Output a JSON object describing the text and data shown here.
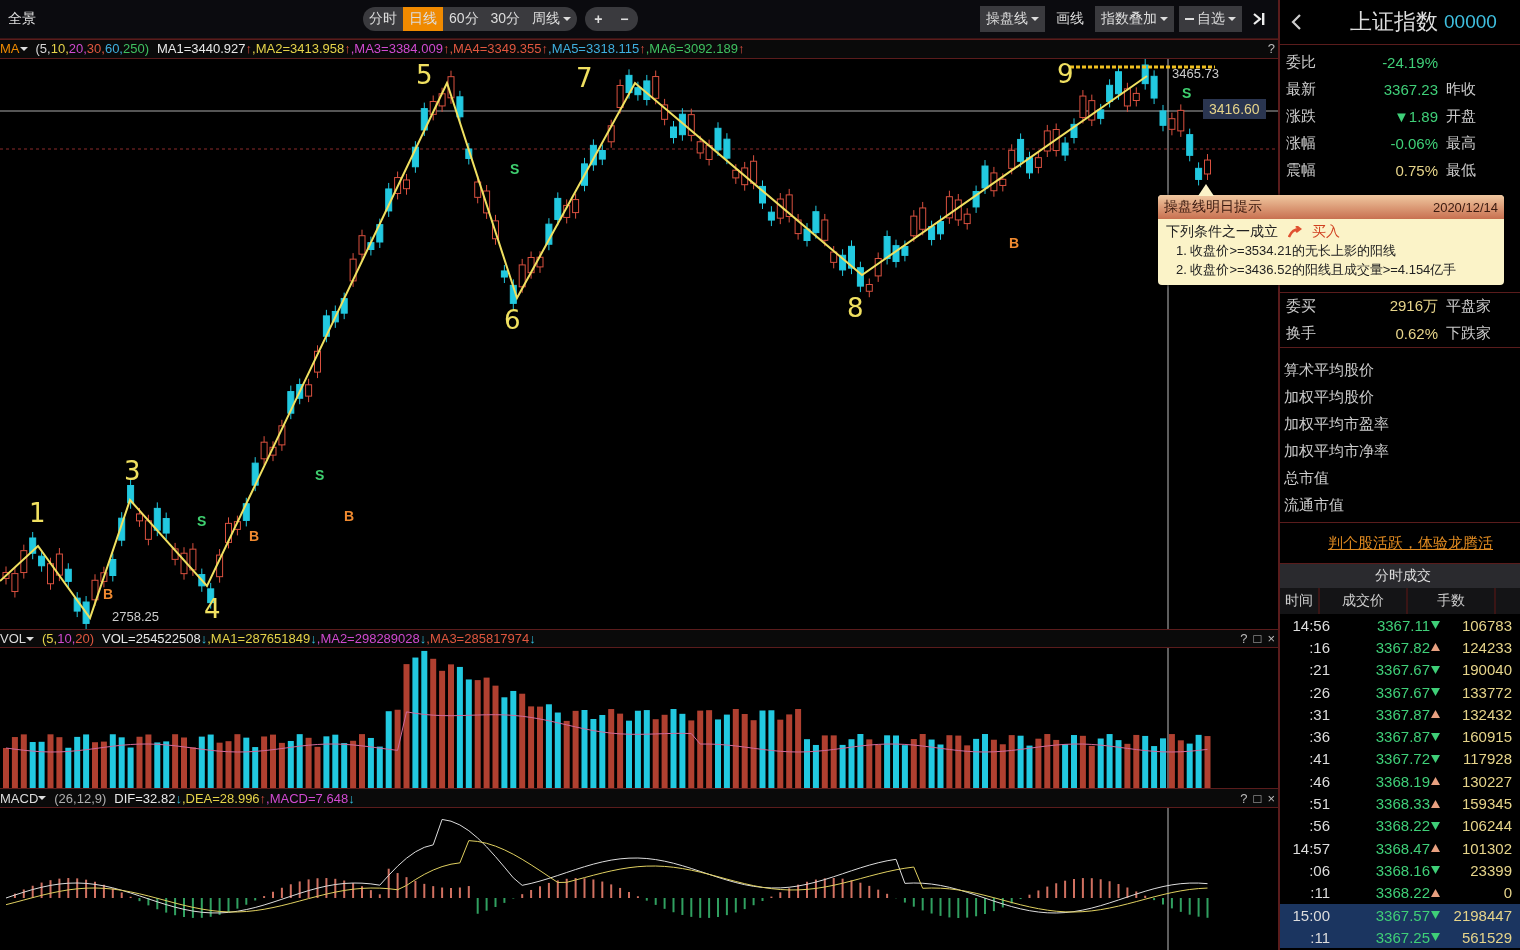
{
  "toolbar": {
    "title": "全景",
    "periods": [
      {
        "label": "分时",
        "selected": false
      },
      {
        "label": "日线",
        "selected": true
      },
      {
        "label": "60分",
        "selected": false
      },
      {
        "label": "30分",
        "selected": false
      },
      {
        "label": "周线",
        "selected": false,
        "dropdown": true
      }
    ],
    "zoom": [
      "+",
      "−"
    ],
    "tools": [
      {
        "label": "操盘线",
        "dropdown": true,
        "minus": false
      },
      {
        "label": "画线",
        "dropdown": false,
        "minus": false
      },
      {
        "label": "指数叠加",
        "dropdown": true,
        "minus": false
      },
      {
        "label": "自选",
        "dropdown": true,
        "minus": true
      }
    ]
  },
  "ma_row": {
    "name": "MA",
    "params": [
      "(5,",
      "10,",
      "20,",
      "30,",
      "60,",
      "250)"
    ],
    "values": [
      {
        "label": "MA1=3440.927",
        "arrow": "↑",
        "rising": true
      },
      {
        "label": ",MA2=3413.958",
        "arrow": "↑",
        "rising": true
      },
      {
        "label": ",MA3=3384.009",
        "arrow": "↑",
        "rising": true
      },
      {
        "label": ",MA4=3349.355",
        "arrow": "↑",
        "rising": true
      },
      {
        "label": ",MA5=3318.115",
        "arrow": "↑",
        "rising": true
      },
      {
        "label": ",MA6=3092.189",
        "arrow": "↑",
        "rising": true
      }
    ],
    "help": "?"
  },
  "chart": {
    "waves": [
      {
        "label": "1"
      },
      {
        "label": "3"
      },
      {
        "label": "4"
      },
      {
        "label": "5"
      },
      {
        "label": "6"
      },
      {
        "label": "7"
      },
      {
        "label": "8"
      },
      {
        "label": "9"
      }
    ],
    "signals": [
      {
        "kind": "buy",
        "text": "B"
      },
      {
        "kind": "sell",
        "text": "S"
      },
      {
        "kind": "buy",
        "text": "B"
      },
      {
        "kind": "sell",
        "text": "S"
      },
      {
        "kind": "buy",
        "text": "B"
      },
      {
        "kind": "sell",
        "text": "S"
      },
      {
        "kind": "buy",
        "text": "B"
      },
      {
        "kind": "sell",
        "text": "S"
      }
    ],
    "low_label": "2758.25",
    "high_label": "3465.73",
    "crosshair_price": "3416.60"
  },
  "vol": {
    "name": "VOL",
    "params": [
      "(5,",
      "10,",
      "20)"
    ],
    "values": [
      {
        "label": "VOL=254522508",
        "arrow": "↓",
        "rising": false
      },
      {
        "label": ",MA1=287651849",
        "arrow": "↓",
        "rising": false
      },
      {
        "label": ",MA2=298289028",
        "arrow": "↓",
        "rising": false
      },
      {
        "label": ",MA3=285817974",
        "arrow": "↓",
        "rising": false
      }
    ],
    "controls": [
      "?",
      "□",
      "×"
    ]
  },
  "macd": {
    "name": "MACD",
    "params": [
      "(26,12,9)"
    ],
    "values": [
      {
        "label": "DIF=32.82",
        "arrow": "↓",
        "rising": false
      },
      {
        "label": ",DEA=28.996",
        "arrow": "↑",
        "rising": true
      },
      {
        "label": ",MACD=7.648",
        "arrow": "↓",
        "rising": false
      }
    ],
    "controls": [
      "?",
      "□",
      "×"
    ]
  },
  "tooltip": {
    "title": "操盘线明日提示",
    "date": "2020/12/14",
    "condition": "下列条件之一成立",
    "action": "买入",
    "items": [
      "1. 收盘价>=3534.21的无长上影的阳线",
      "2. 收盘价>=3436.52的阳线且成交量>=4.154亿手"
    ]
  },
  "panel": {
    "title": "上证指数",
    "code": "00000",
    "quotes_top": [
      {
        "label": "委比",
        "value": "-24.19%",
        "negative": true
      },
      {
        "label": "最新",
        "value": "3367.23",
        "negative": true,
        "label2": "昨收"
      },
      {
        "label": "涨跌",
        "value": "▼1.89",
        "negative": true,
        "label2": "开盘"
      },
      {
        "label": "涨幅",
        "value": "-0.06%",
        "negative": true,
        "label2": "最高"
      },
      {
        "label": "震幅",
        "value": "0.75%",
        "negative": false,
        "label2": "最低"
      }
    ],
    "quotes_bottom": [
      {
        "label": "委买",
        "value": "2916万",
        "negative": false,
        "label2": "平盘家"
      },
      {
        "label": "换手",
        "value": "0.62%",
        "negative": false,
        "label2": "下跌家"
      }
    ],
    "stats": [
      "算术平均股价",
      "加权平均股价",
      "加权平均市盈率",
      "加权平均市净率",
      "总市值",
      "流通市值"
    ],
    "promo": "判个股活跃，体验龙腾活",
    "trades_tab": "分时成交",
    "columns": [
      "时间",
      "成交价",
      "手数"
    ],
    "trades": [
      {
        "time": "14:56",
        "price": "3367.11",
        "rising": false,
        "volume": "106783",
        "selected": false
      },
      {
        "time": ":16",
        "price": "3367.82",
        "rising": true,
        "volume": "124233",
        "selected": false
      },
      {
        "time": ":21",
        "price": "3367.67",
        "rising": false,
        "volume": "190040",
        "selected": false
      },
      {
        "time": ":26",
        "price": "3367.67",
        "rising": false,
        "volume": "133772",
        "selected": false
      },
      {
        "time": ":31",
        "price": "3367.87",
        "rising": true,
        "volume": "132432",
        "selected": false
      },
      {
        "time": ":36",
        "price": "3367.87",
        "rising": false,
        "volume": "160915",
        "selected": false
      },
      {
        "time": ":41",
        "price": "3367.72",
        "rising": false,
        "volume": "117928",
        "selected": false
      },
      {
        "time": ":46",
        "price": "3368.19",
        "rising": true,
        "volume": "130227",
        "selected": false
      },
      {
        "time": ":51",
        "price": "3368.33",
        "rising": true,
        "volume": "159345",
        "selected": false
      },
      {
        "time": ":56",
        "price": "3368.22",
        "rising": false,
        "volume": "106244",
        "selected": false
      },
      {
        "time": "14:57",
        "price": "3368.47",
        "rising": true,
        "volume": "101302",
        "selected": false
      },
      {
        "time": ":06",
        "price": "3368.16",
        "rising": false,
        "volume": "23399",
        "selected": false
      },
      {
        "time": ":11",
        "price": "3368.22",
        "rising": true,
        "volume": "0",
        "selected": false
      },
      {
        "time": "15:00",
        "price": "3367.57",
        "rising": false,
        "volume": "2198447",
        "selected": true
      },
      {
        "time": ":11",
        "price": "3367.25",
        "rising": false,
        "volume": "561529",
        "selected": true
      }
    ]
  }
}
